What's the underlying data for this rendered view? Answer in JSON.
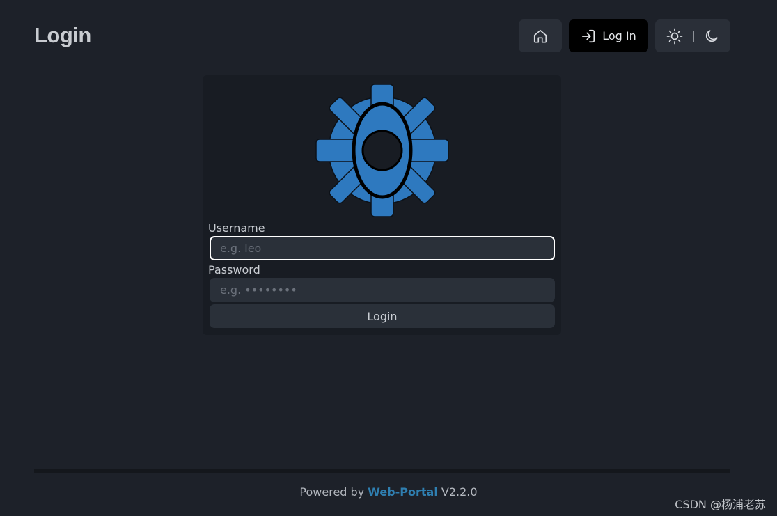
{
  "header": {
    "title": "Login",
    "login_label": "Log In",
    "theme_separator": "|"
  },
  "icons": {
    "home": "home-icon",
    "login": "login-arrow-icon",
    "light": "sun-icon",
    "dark": "moon-icon",
    "logo": "gear-eye-logo"
  },
  "form": {
    "username_label": "Username",
    "username_placeholder": "e.g. leo",
    "password_label": "Password",
    "password_placeholder": "e.g. ••••••••",
    "submit_label": "Login"
  },
  "footer": {
    "prefix": "Powered by",
    "brand": "Web-Portal",
    "version": "V2.2.0"
  },
  "watermark": "CSDN @杨浦老苏",
  "colors": {
    "background": "#1d2129",
    "card": "#181c23",
    "accent": "#2f7fb1",
    "logo_blue": "#2e79bf"
  }
}
